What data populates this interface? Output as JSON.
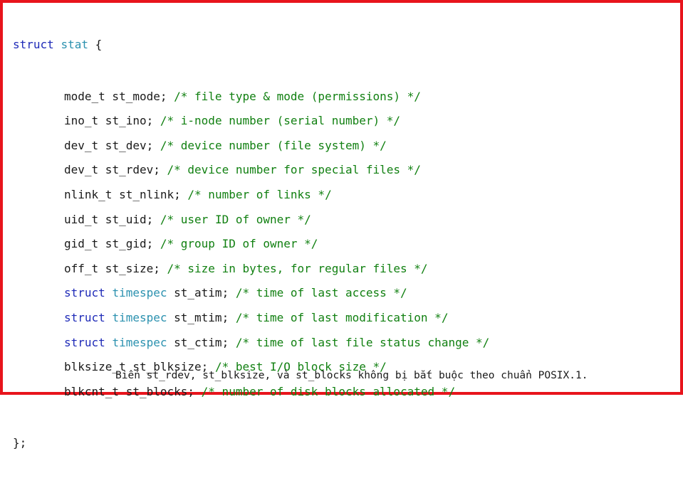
{
  "header": {
    "kw": "struct",
    "name": "stat",
    "brace": " {"
  },
  "fields": [
    {
      "struct_kw": "",
      "type": "mode_t",
      "decl": " st_mode; ",
      "comment": "/* file type & mode (permissions) */"
    },
    {
      "struct_kw": "",
      "type": "ino_t",
      "decl": " st_ino; ",
      "comment": "/* i-node number (serial number) */"
    },
    {
      "struct_kw": "",
      "type": "dev_t",
      "decl": " st_dev; ",
      "comment": "/* device number (file system) */"
    },
    {
      "struct_kw": "",
      "type": "dev_t",
      "decl": " st_rdev; ",
      "comment": "/* device number for special files */"
    },
    {
      "struct_kw": "",
      "type": "nlink_t",
      "decl": " st_nlink; ",
      "comment": "/* number of links */"
    },
    {
      "struct_kw": "",
      "type": "uid_t",
      "decl": " st_uid; ",
      "comment": "/* user ID of owner */"
    },
    {
      "struct_kw": "",
      "type": "gid_t",
      "decl": " st_gid; ",
      "comment": "/* group ID of owner */"
    },
    {
      "struct_kw": "",
      "type": "off_t",
      "decl": " st_size; ",
      "comment": "/* size in bytes, for regular files */"
    },
    {
      "struct_kw": "struct ",
      "type": "timespec",
      "decl": " st_atim; ",
      "comment": "/* time of last access */"
    },
    {
      "struct_kw": "struct ",
      "type": "timespec",
      "decl": " st_mtim; ",
      "comment": "/* time of last modification */"
    },
    {
      "struct_kw": "struct ",
      "type": "timespec",
      "decl": " st_ctim; ",
      "comment": "/* time of last file status change */"
    },
    {
      "struct_kw": "",
      "type": "blksize_t",
      "decl": " st_blksize; ",
      "comment": "/* best I/O block size */"
    },
    {
      "struct_kw": "",
      "type": "blkcnt_t",
      "decl": " st_blocks; ",
      "comment": "/* number of disk blocks allocated */"
    }
  ],
  "closing": "};",
  "note": "Biến st_rdev, st_blksize, và st_blocks không bị bắt buộc theo chuẩn POSIX.1.",
  "colors": {
    "border": "#e8141c",
    "keyword": "#1f2bb8",
    "type_name": "#2b91af",
    "comment": "#118011",
    "text": "#1a1a1a"
  }
}
